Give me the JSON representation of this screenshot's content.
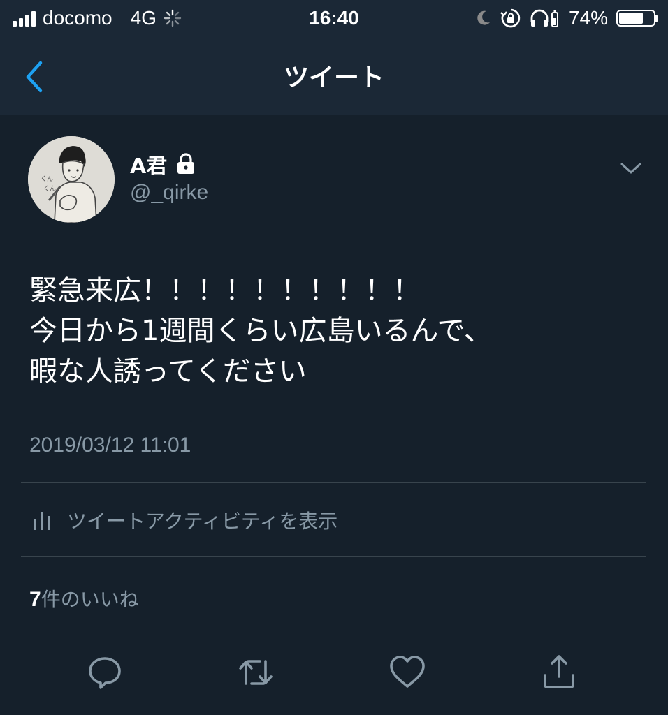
{
  "status_bar": {
    "carrier": "docomo",
    "network": "4G",
    "time": "16:40",
    "battery_percent": "74%",
    "battery_level": 0.74
  },
  "nav": {
    "title": "ツイート"
  },
  "tweet": {
    "display_name": "A君",
    "handle": "@_qirke",
    "text_lines": [
      "緊急来広！！！！！！！！！！",
      "今日から1週間くらい広島いるんで、",
      "暇な人誘ってください"
    ],
    "timestamp": "2019/03/12 11:01"
  },
  "activity": {
    "label": "ツイートアクティビティを表示"
  },
  "likes": {
    "count": "7",
    "suffix": "件のいいね"
  },
  "colors": {
    "background": "#15202b",
    "bar": "#1b2836",
    "accent": "#1da1f2",
    "secondary_text": "#8899a6",
    "divider": "#38444d"
  },
  "icons": {
    "status": [
      "signal-bars-icon",
      "loading-spinner-icon",
      "moon-icon",
      "rotation-lock-icon",
      "headphones-icon",
      "battery-icon"
    ],
    "nav": [
      "back-chevron-icon"
    ],
    "header": [
      "lock-icon",
      "chevron-down-icon"
    ],
    "activity": "bar-chart-icon",
    "actions": [
      "reply-icon",
      "retweet-icon",
      "like-icon",
      "share-icon"
    ]
  }
}
